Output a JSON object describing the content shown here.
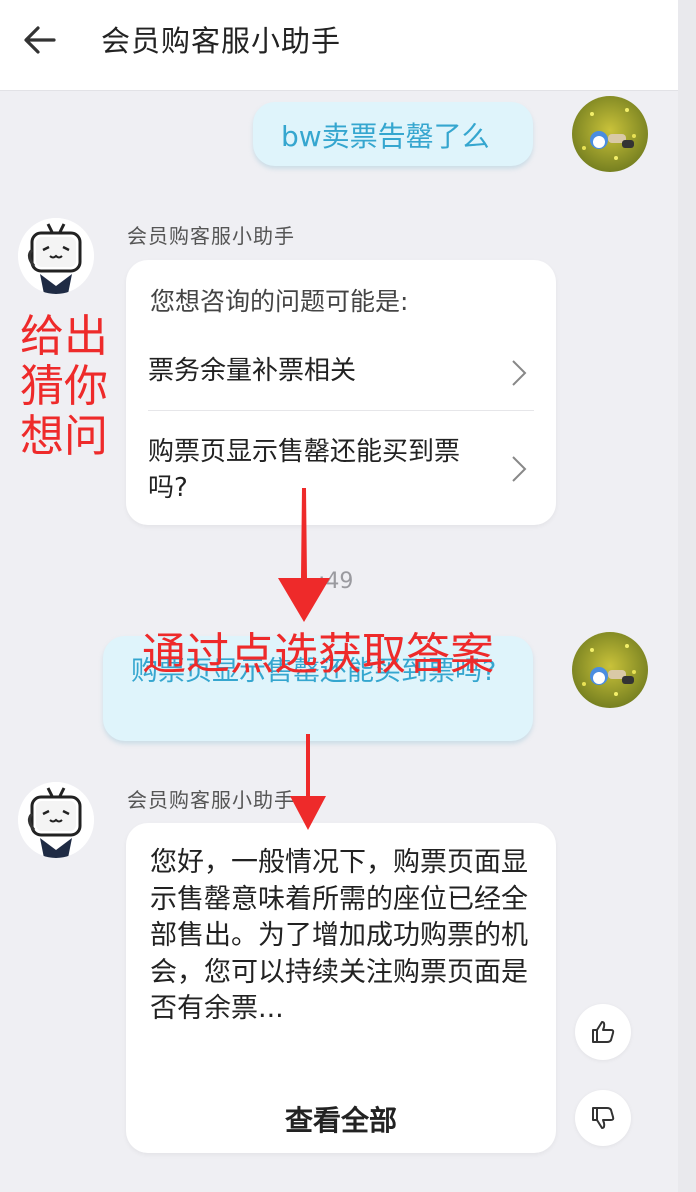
{
  "header": {
    "title": "会员购客服小助手"
  },
  "messages": {
    "user_1": "bw卖票告罄了么",
    "bot_name": "会员购客服小助手",
    "suggestions": {
      "intro": "您想咨询的问题可能是:",
      "items": [
        {
          "label": "票务余量补票相关"
        },
        {
          "label": "购票页显示售罄还能买到票吗?"
        }
      ]
    },
    "time_label": ":49",
    "user_2": "购票页显示售罄还能买到票吗?",
    "answer": {
      "text": "您好，一般情况下，购票页面显示售罄意味着所需的座位已经全部售出。为了增加成功购票的机会，您可以持续关注购票页面是否有余票...",
      "see_all": "查看全部"
    }
  },
  "annotations": {
    "left_note": "给出猜你想问",
    "center_note": "通过点选获取答案",
    "color": "#ee2a2a"
  },
  "icons": [
    "back-arrow-icon",
    "chevron-right-icon",
    "thumbs-up-icon",
    "thumbs-down-icon"
  ]
}
